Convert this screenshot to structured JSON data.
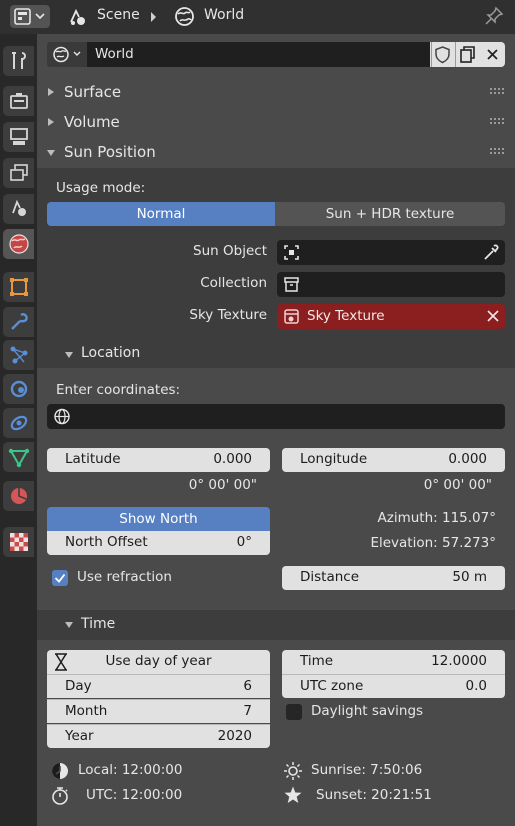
{
  "header": {
    "scene_label": "Scene",
    "world_label": "World"
  },
  "world_selector": {
    "name": "World"
  },
  "sections": {
    "surface": "Surface",
    "volume": "Volume",
    "sun_position": "Sun Position"
  },
  "usage": {
    "label": "Usage mode:",
    "options": [
      "Normal",
      "Sun + HDR texture"
    ],
    "selected": "Normal"
  },
  "props": {
    "sun_object_label": "Sun Object",
    "collection_label": "Collection",
    "sky_texture_label": "Sky Texture",
    "sky_texture_value": "Sky Texture"
  },
  "location": {
    "title": "Location",
    "enter_coords_label": "Enter coordinates:",
    "coords_value": "",
    "latitude_label": "Latitude",
    "latitude_value": "0.000",
    "latitude_dms": "0° 00' 00\"",
    "longitude_label": "Longitude",
    "longitude_value": "0.000",
    "longitude_dms": "0° 00' 00\"",
    "show_north_label": "Show North",
    "north_offset_label": "North Offset",
    "north_offset_value": "0°",
    "azimuth": "Azimuth: 115.07°",
    "elevation": "Elevation: 57.273°",
    "use_refraction_label": "Use refraction",
    "use_refraction_checked": true,
    "distance_label": "Distance",
    "distance_value": "50 m"
  },
  "time": {
    "title": "Time",
    "use_day_of_year_label": "Use day of year",
    "day_label": "Day",
    "day_value": "6",
    "month_label": "Month",
    "month_value": "7",
    "year_label": "Year",
    "year_value": "2020",
    "time_label": "Time",
    "time_value": "12.0000",
    "utc_zone_label": "UTC zone",
    "utc_zone_value": "0.0",
    "daylight_savings_label": "Daylight savings",
    "daylight_savings_checked": false,
    "local_time": "Local: 12:00:00",
    "utc_time": "UTC: 12:00:00",
    "sunrise": "Sunrise: 7:50:06",
    "sunset": "Sunset: 20:21:51"
  },
  "colors": {
    "accent_blue": "#5680c2",
    "sky_texture_red": "#8b1e1e",
    "world_tab_red": "#c64545"
  }
}
